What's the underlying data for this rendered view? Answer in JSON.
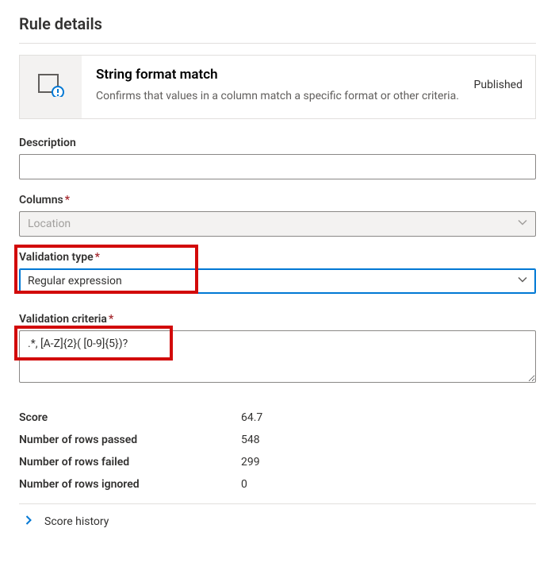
{
  "page_title": "Rule details",
  "card": {
    "title": "String format match",
    "description": "Confirms that values in a column match a specific format or other criteria.",
    "status": "Published"
  },
  "fields": {
    "description": {
      "label": "Description",
      "value": ""
    },
    "columns": {
      "label": "Columns",
      "required": true,
      "value": "Location"
    },
    "validation_type": {
      "label": "Validation type",
      "required": true,
      "value": "Regular expression"
    },
    "validation_criteria": {
      "label": "Validation criteria",
      "required": true,
      "value": ".*, [A-Z]{2}( [0-9]{5})?"
    }
  },
  "stats": {
    "score": {
      "label": "Score",
      "value": "64.7"
    },
    "passed": {
      "label": "Number of rows passed",
      "value": "548"
    },
    "failed": {
      "label": "Number of rows failed",
      "value": "299"
    },
    "ignored": {
      "label": "Number of rows ignored",
      "value": "0"
    }
  },
  "expander": {
    "label": "Score history"
  }
}
